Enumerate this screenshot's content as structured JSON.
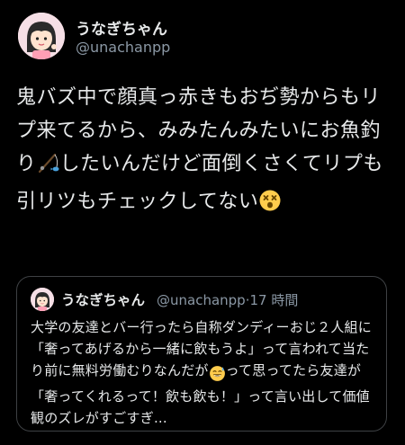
{
  "author": {
    "display_name": "うなぎちゃん",
    "handle": "@unachanpp"
  },
  "tweet": {
    "text_part1": "鬼バズ中で顔真っ赤きもおぢ勢からもリプ来てるから、みみたんみたいにお魚釣り",
    "text_part2": "したいんだけど面倒くさくてリプも引リツもチェックしてない",
    "emoji_1": "fishing-pole-icon",
    "emoji_2": "dizzy-face-icon"
  },
  "quote": {
    "display_name": "うなぎちゃん",
    "handle": "@unachanpp",
    "separator": "·",
    "time": "17 時間",
    "text_part1": "大学の友達とバー行ったら自称ダンディーおじ２人組に「奢ってあげるから一緒に飲もうよ」って言われて当たり前に無料労働むりなんだが",
    "text_part2": "って思ってたら友達が「奢ってくれるって！飲も飲も！」って言い出して価値観のズレがすごすぎ...",
    "emoji": "grinning-sweat-icon"
  },
  "colors": {
    "background": "#000000",
    "primary_text": "#e7e9ea",
    "secondary_text": "#8b98a5",
    "card_border": "#3e4144"
  }
}
